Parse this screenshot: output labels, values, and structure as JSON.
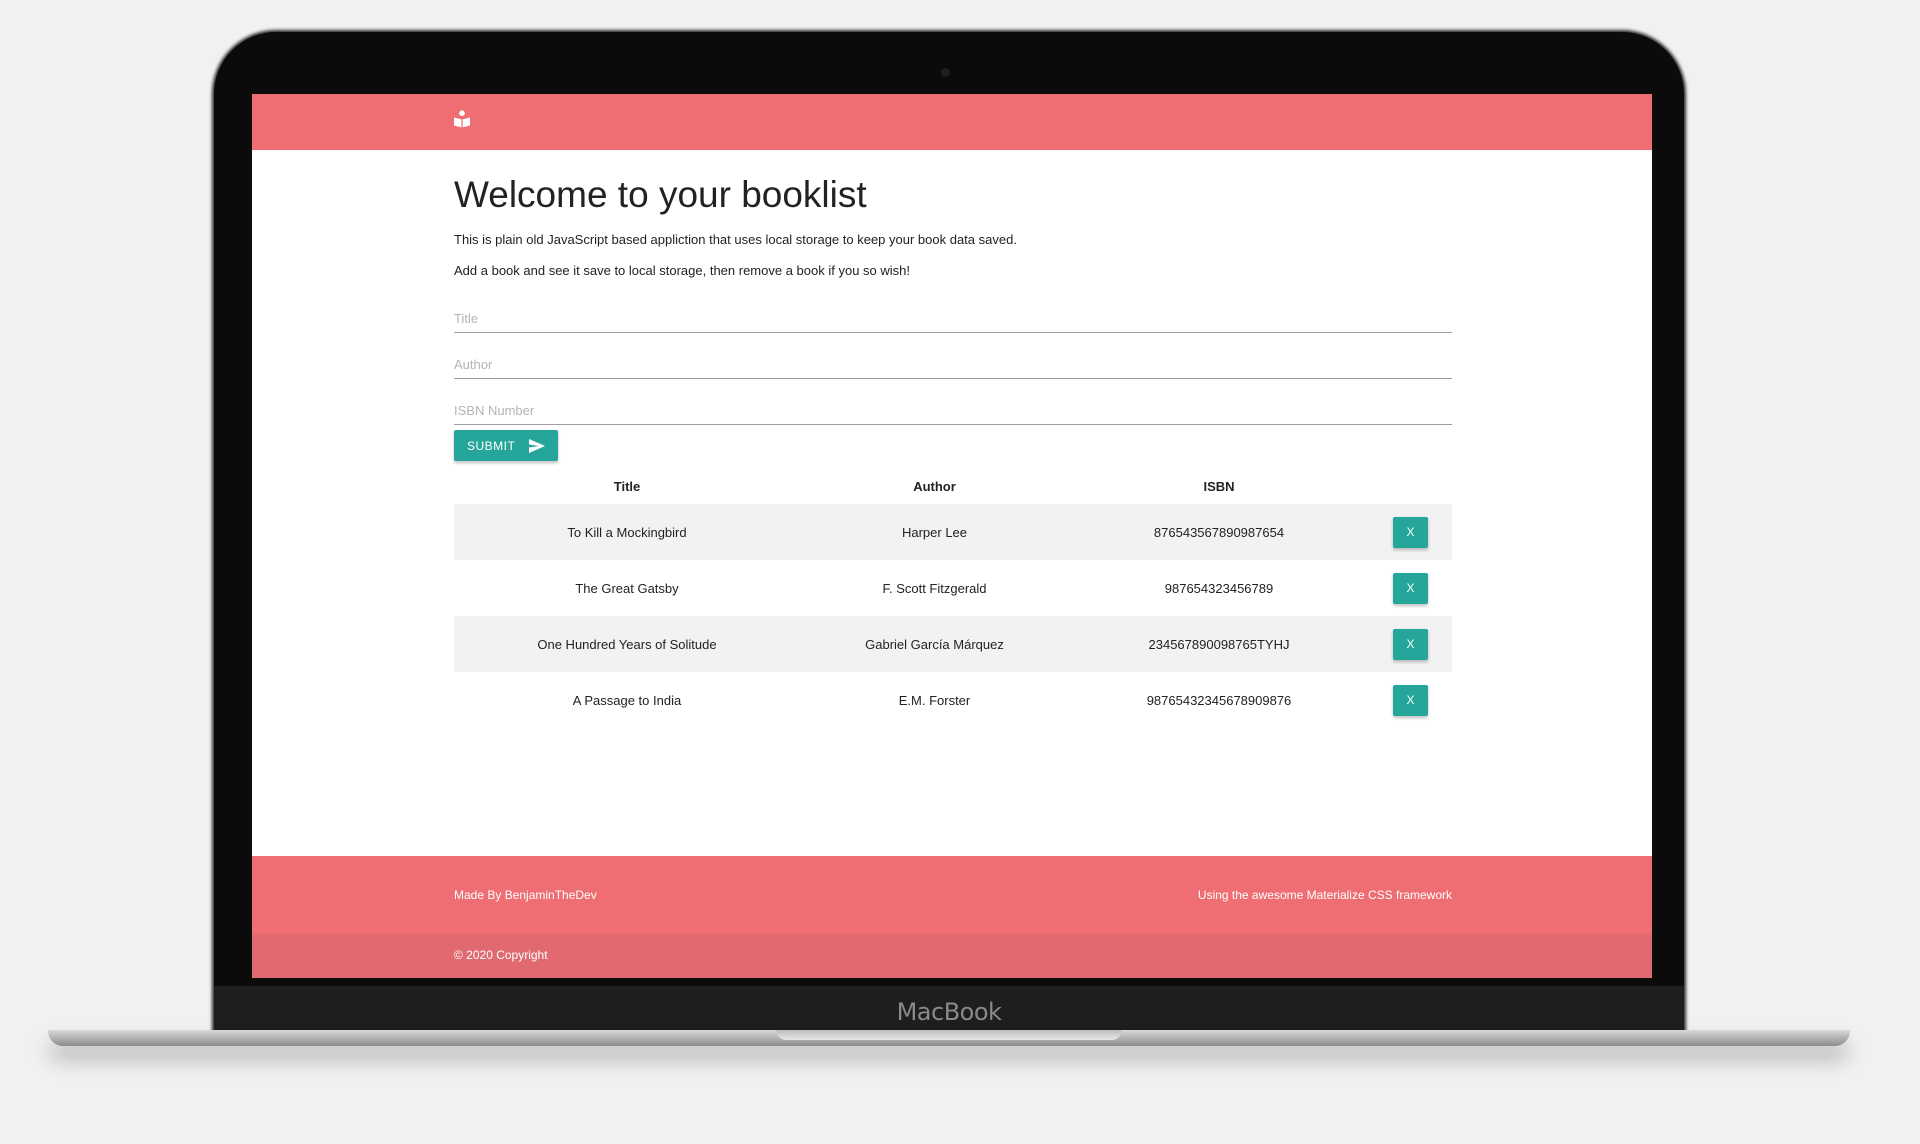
{
  "device": {
    "brand_label": "MacBook"
  },
  "navbar": {
    "brand_icon": "book-reader-icon",
    "color": "#ef6e73"
  },
  "main": {
    "title": "Welcome to your booklist",
    "intro_1": "This is plain old JavaScript based appliction that uses local storage to keep your book data saved.",
    "intro_2": "Add a book and see it save to local storage, then remove a book if you so wish!"
  },
  "form": {
    "title_placeholder": "Title",
    "author_placeholder": "Author",
    "isbn_placeholder": "ISBN Number",
    "submit_label": "SUBMIT",
    "submit_icon": "send-icon",
    "button_color": "#26a69a"
  },
  "table": {
    "headers": [
      "Title",
      "Author",
      "ISBN",
      ""
    ],
    "rows": [
      {
        "title": "To Kill a Mockingbird",
        "author": "Harper Lee",
        "isbn": "876543567890987654",
        "delete_label": "X"
      },
      {
        "title": "The Great Gatsby",
        "author": "F. Scott Fitzgerald",
        "isbn": "987654323456789",
        "delete_label": "X"
      },
      {
        "title": "One Hundred Years of Solitude",
        "author": "Gabriel García Márquez",
        "isbn": "234567890098765TYHJ",
        "delete_label": "X"
      },
      {
        "title": "A Passage to India",
        "author": "E.M. Forster",
        "isbn": "98765432345678909876",
        "delete_label": "X"
      }
    ]
  },
  "footer": {
    "left_text": "Made By BenjaminTheDev",
    "right_text": "Using the awesome Materialize CSS framework",
    "copyright": "© 2020 Copyright"
  }
}
